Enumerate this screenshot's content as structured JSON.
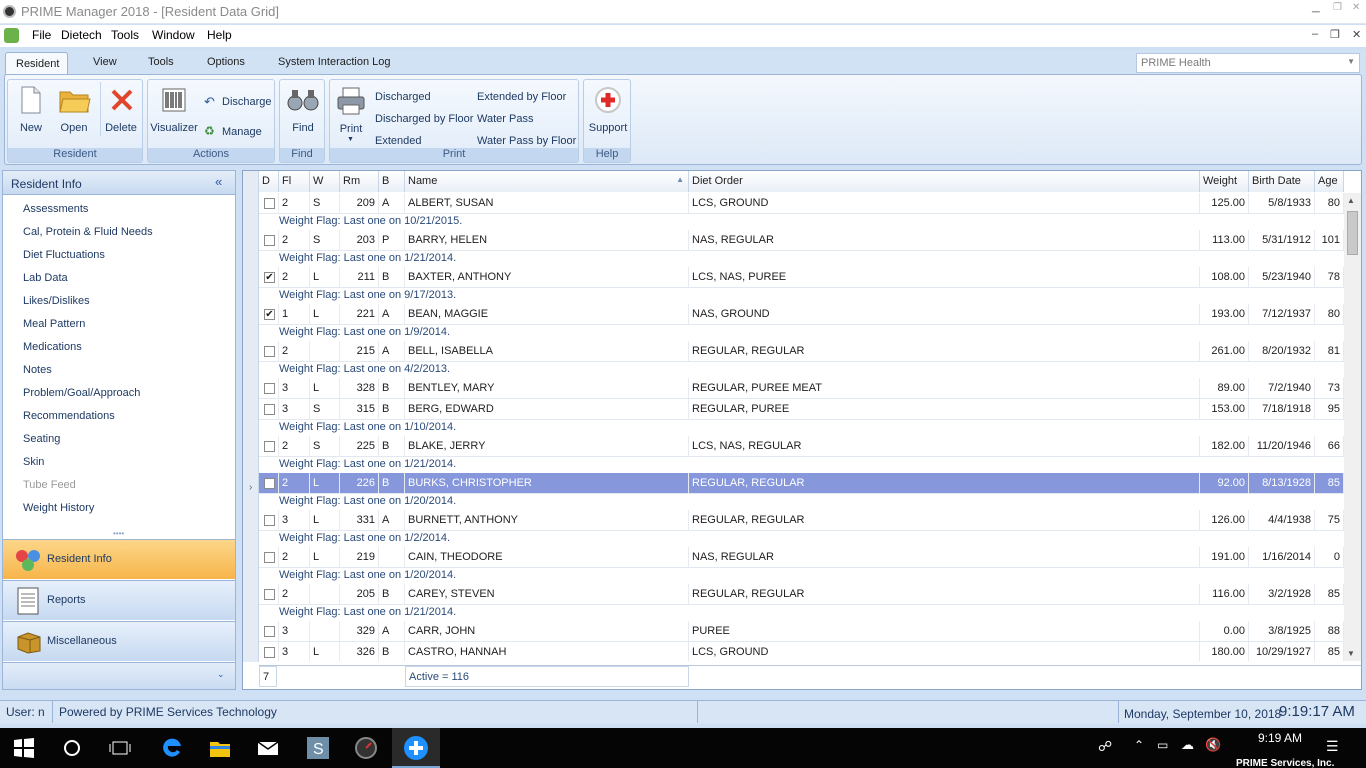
{
  "window": {
    "title": "PRIME Manager 2018 - [Resident Data Grid]"
  },
  "menu": [
    "File",
    "Dietech",
    "Tools",
    "Window",
    "Help"
  ],
  "ribbon_tabs": [
    "Resident",
    "View",
    "Tools",
    "Options",
    "System Interaction Log"
  ],
  "org_selector": "PRIME Health",
  "ribbon": {
    "resident_group": {
      "label": "Resident",
      "new": "New",
      "open": "Open",
      "delete": "Delete"
    },
    "actions_group": {
      "label": "Actions",
      "visualizer": "Visualizer",
      "discharge": "Discharge",
      "manage": "Manage"
    },
    "find_group": {
      "label": "Find",
      "find": "Find"
    },
    "print_group": {
      "label": "Print",
      "print": "Print",
      "links": [
        "Discharged",
        "Discharged by Floor",
        "Extended",
        "Extended by Floor",
        "Water Pass",
        "Water Pass by Floor"
      ]
    },
    "help_group": {
      "label": "Help",
      "support": "Support"
    }
  },
  "sidebar": {
    "header": "Resident Info",
    "items": [
      "Assessments",
      "Cal, Protein & Fluid Needs",
      "Diet Fluctuations",
      "Lab Data",
      "Likes/Dislikes",
      "Meal Pattern",
      "Medications",
      "Notes",
      "Problem/Goal/Approach",
      "Recommendations",
      "Seating",
      "Skin",
      "Tube Feed",
      "Weight History"
    ],
    "sections": [
      "Resident Info",
      "Reports",
      "Miscellaneous"
    ]
  },
  "grid": {
    "columns": [
      "D",
      "Fl",
      "W",
      "Rm",
      "B",
      "Name",
      "Diet Order",
      "Weight",
      "Birth Date",
      "Age"
    ],
    "rows": [
      {
        "d": false,
        "fl": "2",
        "w": "S",
        "rm": "209",
        "b": "A",
        "name": "ALBERT, SUSAN",
        "diet": "LCS, GROUND",
        "weight": "125.00",
        "birth": "5/8/1933",
        "age": "80",
        "flag": "Weight Flag: Last one on 10/21/2015."
      },
      {
        "d": false,
        "fl": "2",
        "w": "S",
        "rm": "203",
        "b": "P",
        "name": "BARRY, HELEN",
        "diet": "NAS, REGULAR",
        "weight": "113.00",
        "birth": "5/31/1912",
        "age": "101",
        "flag": "Weight Flag: Last one on 1/21/2014."
      },
      {
        "d": true,
        "fl": "2",
        "w": "L",
        "rm": "211",
        "b": "B",
        "name": "BAXTER, ANTHONY",
        "diet": "LCS, NAS, PUREE",
        "weight": "108.00",
        "birth": "5/23/1940",
        "age": "78",
        "flag": "Weight Flag: Last one on 9/17/2013."
      },
      {
        "d": true,
        "fl": "1",
        "w": "L",
        "rm": "221",
        "b": "A",
        "name": "BEAN, MAGGIE",
        "diet": "NAS, GROUND",
        "weight": "193.00",
        "birth": "7/12/1937",
        "age": "80",
        "flag": "Weight Flag: Last one on 1/9/2014."
      },
      {
        "d": false,
        "fl": "2",
        "w": "",
        "rm": "215",
        "b": "A",
        "name": "BELL, ISABELLA",
        "diet": "REGULAR, REGULAR",
        "weight": "261.00",
        "birth": "8/20/1932",
        "age": "81",
        "flag": "Weight Flag: Last one on 4/2/2013."
      },
      {
        "d": false,
        "fl": "3",
        "w": "L",
        "rm": "328",
        "b": "B",
        "name": "BENTLEY, MARY",
        "diet": "REGULAR, PUREE MEAT",
        "weight": "89.00",
        "birth": "7/2/1940",
        "age": "73",
        "flag": ""
      },
      {
        "d": false,
        "fl": "3",
        "w": "S",
        "rm": "315",
        "b": "B",
        "name": "BERG, EDWARD",
        "diet": "REGULAR, PUREE",
        "weight": "153.00",
        "birth": "7/18/1918",
        "age": "95",
        "flag": "Weight Flag: Last one on 1/10/2014."
      },
      {
        "d": false,
        "fl": "2",
        "w": "S",
        "rm": "225",
        "b": "B",
        "name": "BLAKE, JERRY",
        "diet": "LCS, NAS, REGULAR",
        "weight": "182.00",
        "birth": "11/20/1946",
        "age": "66",
        "flag": "Weight Flag: Last one on 1/21/2014."
      },
      {
        "d": false,
        "fl": "2",
        "w": "L",
        "rm": "226",
        "b": "B",
        "name": "BURKS, CHRISTOPHER",
        "diet": "REGULAR, REGULAR",
        "weight": "92.00",
        "birth": "8/13/1928",
        "age": "85",
        "flag": "Weight Flag: Last one on 1/20/2014.",
        "selected": true
      },
      {
        "d": false,
        "fl": "3",
        "w": "L",
        "rm": "331",
        "b": "A",
        "name": "BURNETT, ANTHONY",
        "diet": "REGULAR, REGULAR",
        "weight": "126.00",
        "birth": "4/4/1938",
        "age": "75",
        "flag": "Weight Flag: Last one on 1/2/2014."
      },
      {
        "d": false,
        "fl": "2",
        "w": "L",
        "rm": "219",
        "b": "",
        "name": "CAIN, THEODORE",
        "diet": "NAS, REGULAR",
        "weight": "191.00",
        "birth": "1/16/2014",
        "age": "0",
        "flag": "Weight Flag: Last one on 1/20/2014."
      },
      {
        "d": false,
        "fl": "2",
        "w": "",
        "rm": "205",
        "b": "B",
        "name": "CAREY, STEVEN",
        "diet": "REGULAR, REGULAR",
        "weight": "116.00",
        "birth": "3/2/1928",
        "age": "85",
        "flag": "Weight Flag: Last one on 1/21/2014."
      },
      {
        "d": false,
        "fl": "3",
        "w": "",
        "rm": "329",
        "b": "A",
        "name": "CARR, JOHN",
        "diet": "PUREE",
        "weight": "0.00",
        "birth": "3/8/1925",
        "age": "88",
        "flag": ""
      },
      {
        "d": false,
        "fl": "3",
        "w": "L",
        "rm": "326",
        "b": "B",
        "name": "CASTRO, HANNAH",
        "diet": "LCS, GROUND",
        "weight": "180.00",
        "birth": "10/29/1927",
        "age": "85",
        "flag": ""
      }
    ],
    "footer_count": "7",
    "footer_active": "Active = 116"
  },
  "status": {
    "user": "User: n",
    "powered": "Powered by PRIME Services Technology",
    "datetime": "Monday, September 10, 2018",
    "time_big": "9:19:17 AM"
  },
  "taskbar": {
    "clock": "9:19 AM",
    "app_hint": "PRIME Services, Inc."
  }
}
